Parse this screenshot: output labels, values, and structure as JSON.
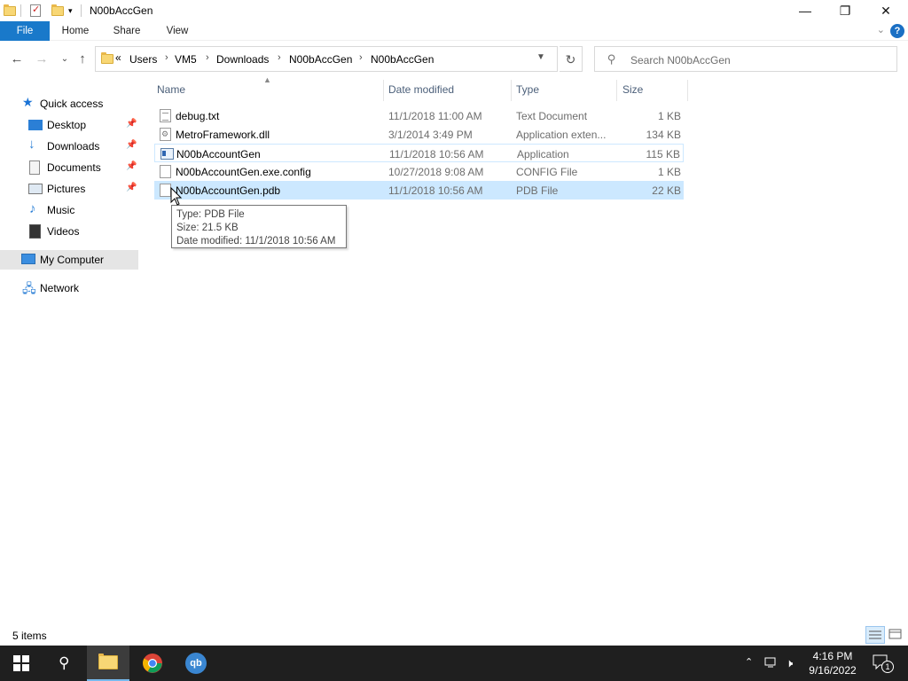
{
  "window": {
    "title": "N00bAccGen",
    "minimize": "—",
    "restore": "❐",
    "close": "✕"
  },
  "ribbon": {
    "tabs": [
      "File",
      "Home",
      "Share",
      "View"
    ],
    "expand_glyph": "⌄",
    "help_glyph": "?"
  },
  "address": {
    "overflow": "«",
    "crumbs": [
      "Users",
      "VM5",
      "Downloads",
      "N00bAccGen",
      "N00bAccGen"
    ],
    "separator": "›",
    "search_placeholder": "Search N00bAccGen"
  },
  "nav": {
    "quick_access": "Quick access",
    "items": [
      {
        "label": "Desktop",
        "icon": "desktop-icon",
        "pinned": true
      },
      {
        "label": "Downloads",
        "icon": "downloads-icon",
        "pinned": true
      },
      {
        "label": "Documents",
        "icon": "documents-icon",
        "pinned": true
      },
      {
        "label": "Pictures",
        "icon": "pictures-icon",
        "pinned": true
      },
      {
        "label": "Music",
        "icon": "music-icon",
        "pinned": false
      },
      {
        "label": "Videos",
        "icon": "videos-icon",
        "pinned": false
      }
    ],
    "my_computer": "My Computer",
    "network": "Network"
  },
  "columns": {
    "name": "Name",
    "date": "Date modified",
    "type": "Type",
    "size": "Size"
  },
  "files": [
    {
      "name": "debug.txt",
      "date": "11/1/2018 11:00 AM",
      "type": "Text Document",
      "size": "1 KB",
      "icon": "text-file-icon"
    },
    {
      "name": "MetroFramework.dll",
      "date": "3/1/2014 3:49 PM",
      "type": "Application exten...",
      "size": "134 KB",
      "icon": "dll-file-icon"
    },
    {
      "name": "N00bAccountGen",
      "date": "11/1/2018 10:56 AM",
      "type": "Application",
      "size": "115 KB",
      "icon": "application-icon"
    },
    {
      "name": "N00bAccountGen.exe.config",
      "date": "10/27/2018 9:08 AM",
      "type": "CONFIG File",
      "size": "1 KB",
      "icon": "config-file-icon"
    },
    {
      "name": "N00bAccountGen.pdb",
      "date": "11/1/2018 10:56 AM",
      "type": "PDB File",
      "size": "22 KB",
      "icon": "pdb-file-icon"
    }
  ],
  "tooltip": {
    "type": "Type: PDB File",
    "size": "Size: 21.5 KB",
    "modified": "Date modified: 11/1/2018 10:56 AM"
  },
  "status": {
    "count": "5 items"
  },
  "taskbar": {
    "time": "4:16 PM",
    "date": "9/16/2022",
    "notification_count": "1",
    "qb_label": "qb"
  },
  "colors": {
    "file_tab": "#1979ca",
    "selection": "#cce8ff",
    "taskbar": "#1f1f1f"
  }
}
